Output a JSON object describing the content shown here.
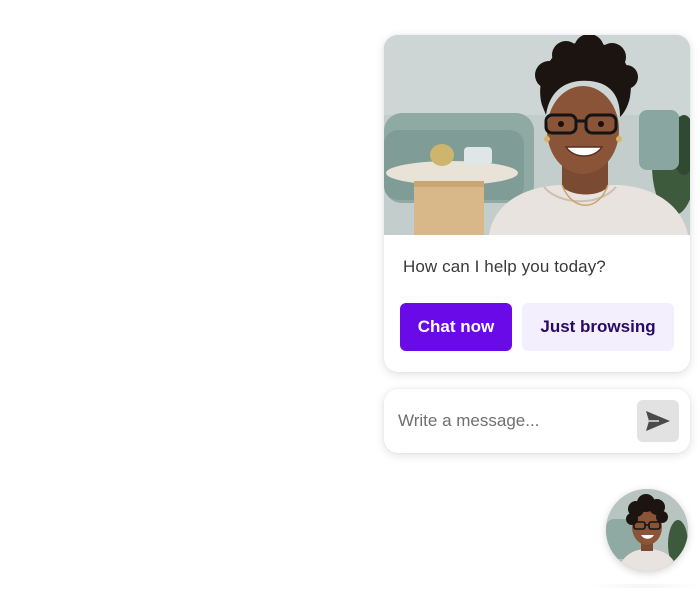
{
  "greeting_card": {
    "message": "How can I help you today?",
    "chat_now_label": "Chat now",
    "just_browsing_label": "Just browsing",
    "primary_color": "#6b0ae8"
  },
  "composer": {
    "placeholder": "Write a message..."
  },
  "icons": {
    "send": "send-icon",
    "agent_photo": "agent-photo",
    "launcher_avatar": "agent-avatar"
  }
}
